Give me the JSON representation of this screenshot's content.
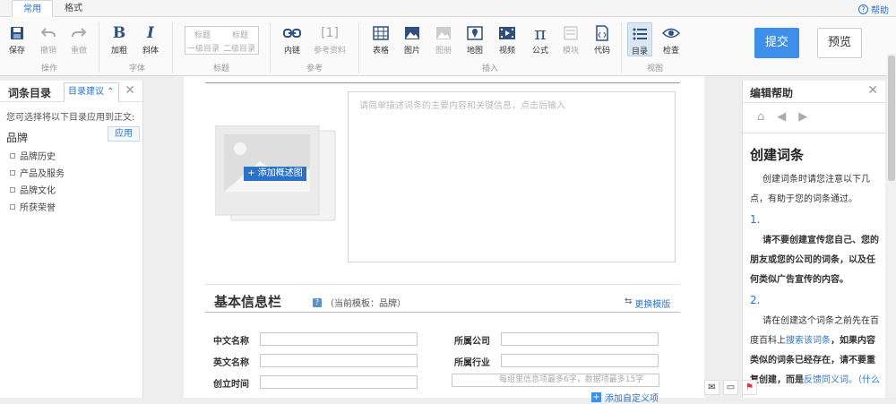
{
  "tabs": {
    "common": "常用",
    "format": "格式"
  },
  "help": "帮助",
  "toolbar": {
    "save": "保存",
    "undo": "撤销",
    "redo": "重做",
    "bold": "加粗",
    "italic": "斜体",
    "heading1_top": "标题",
    "heading2_top": "标题",
    "heading1_bottom": "一级目录",
    "heading2_bottom": "二级目录",
    "innerlink": "内链",
    "reference": "参考资料",
    "ref_glyph": "[1]",
    "table": "表格",
    "image": "图片",
    "album": "图册",
    "map": "地图",
    "video": "视频",
    "formula": "公式",
    "module": "模块",
    "code": "代码",
    "toc": "目录",
    "check": "检查",
    "groups": {
      "operate": "操作",
      "font": "字体",
      "title": "标题",
      "ref": "参考",
      "insert": "插入",
      "view": "视图"
    },
    "submit": "提交",
    "preview": "预览"
  },
  "left_panel": {
    "title": "词条目录",
    "tab": "目录建议",
    "hint": "您可选择将以下目录应用到正文:",
    "category": "品牌",
    "apply": "应用",
    "items": [
      "品牌历史",
      "产品及服务",
      "品牌文化",
      "所获荣誉"
    ]
  },
  "editor": {
    "add_image": "添加概述图",
    "summary_placeholder": "请简单描述词条的主要内容和关键信息，点击后输入",
    "info_title": "基本信息栏",
    "template_note": "（当前模板：品牌）",
    "change_template": "更换模版",
    "fields_left": [
      "中文名称",
      "英文名称",
      "创立时间"
    ],
    "fields_right": [
      "所属公司",
      "所属行业"
    ],
    "custom_placeholder": "每组里信息项最多6字，数据项最多15字",
    "add_custom": "添加自定义项"
  },
  "right_panel": {
    "title": "编辑帮助",
    "heading": "创建词条",
    "intro": "创建词条时请您注意以下几点，有助于您的词条通过。",
    "num1": "1.",
    "rule1": "请不要创建宣传您自己、您的朋友或您的公司的词条，以及任何类似广告宣传的内容。",
    "num2": "2.",
    "rule2_a": "请在创建这个词条之前先在百度百科上",
    "rule2_link": "搜索该词条",
    "rule2_b": "，如果内容类似的词条已经存在，请不要重复创建，而是",
    "rule2_link2": "反馈同义词",
    "rule2_c": "。（什么"
  },
  "colors": {
    "accent": "#3e8fe9",
    "link": "#2b74c7"
  }
}
